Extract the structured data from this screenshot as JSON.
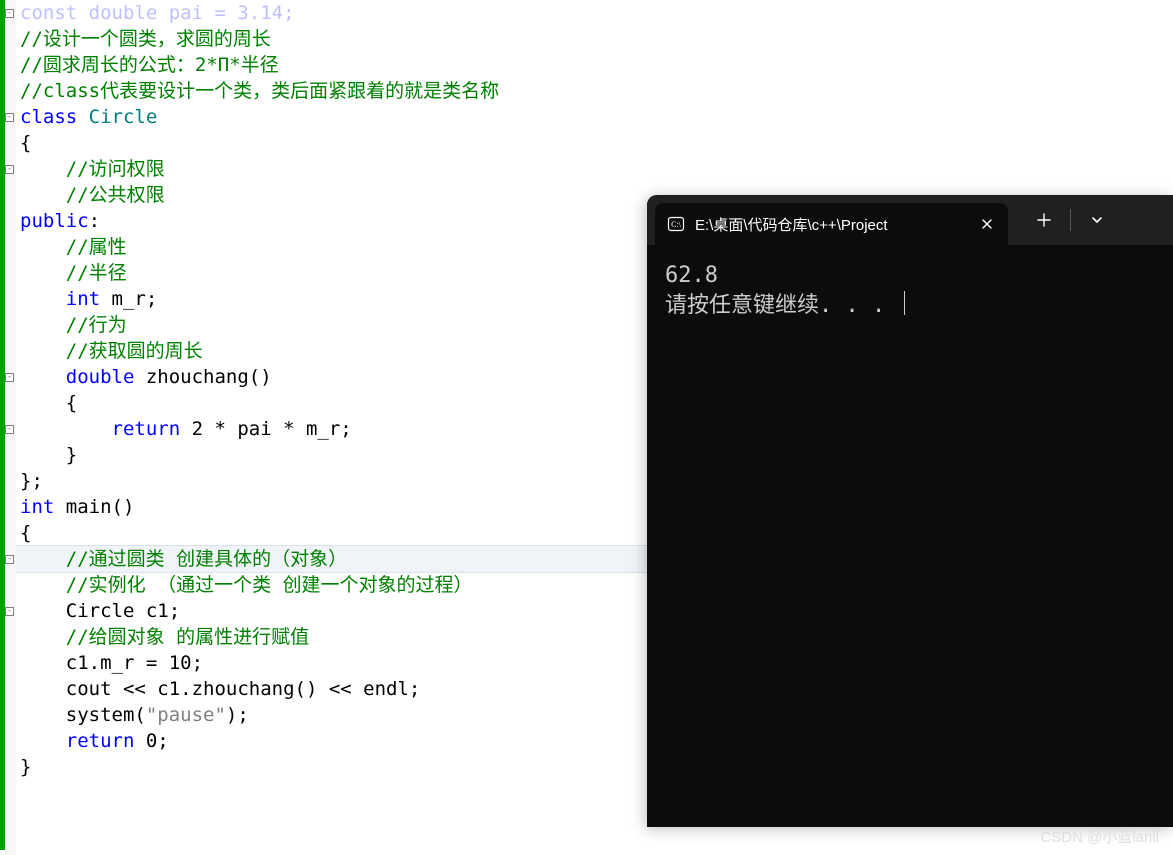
{
  "code": {
    "l00": "const double pai = 3.14;",
    "l01a": "//设计一个圆类，求圆的周长",
    "l01b": "//圆求周长的公式：2*Π*半径",
    "l02": "",
    "l03": "//class代表要设计一个类，类后面紧跟着的就是类名称",
    "l04_kw": "class",
    "l04_name": " Circle",
    "l05": "{",
    "l06a": "    //访问权限",
    "l06b": "    //公共权限",
    "l07_kw": "public",
    "l07_colon": ":",
    "l08": "",
    "l09a": "    //属性",
    "l09b": "    //半径",
    "l10_kw": "    int",
    "l10_rest": " m_r;",
    "l11": "",
    "l12a": "    //行为",
    "l12b": "    //获取圆的周长",
    "l13_kw": "    double",
    "l13_rest": " zhouchang()",
    "l14": "    {",
    "l15_pre": "        ",
    "l15_kw": "return",
    "l15_rest": " 2 * pai * m_r;",
    "l16": "    }",
    "l17": "};",
    "l18_kw": "int",
    "l18_rest": " main()",
    "l19": "{",
    "l20a": "    //通过圆类 创建具体的（对象）",
    "l20b": "    //实例化 （通过一个类 创建一个对象的过程）",
    "l21": "    Circle c1;",
    "l22": "    //给圆对象 的属性进行赋值",
    "l23": "    c1.m_r = 10;",
    "l24": "",
    "l25": "    cout << c1.zhouchang() << endl;",
    "l26_pre": "    system(",
    "l26_str": "\"pause\"",
    "l26_post": ");",
    "l27_pre": "    ",
    "l27_kw": "return",
    "l27_rest": " 0;",
    "l28": "}"
  },
  "terminal": {
    "tab_title": "E:\\桌面\\代码仓库\\c++\\Project",
    "out1": "62.8",
    "out2": "请按任意键继续. . . "
  },
  "watermark": "CSDN @小蓝lanll"
}
